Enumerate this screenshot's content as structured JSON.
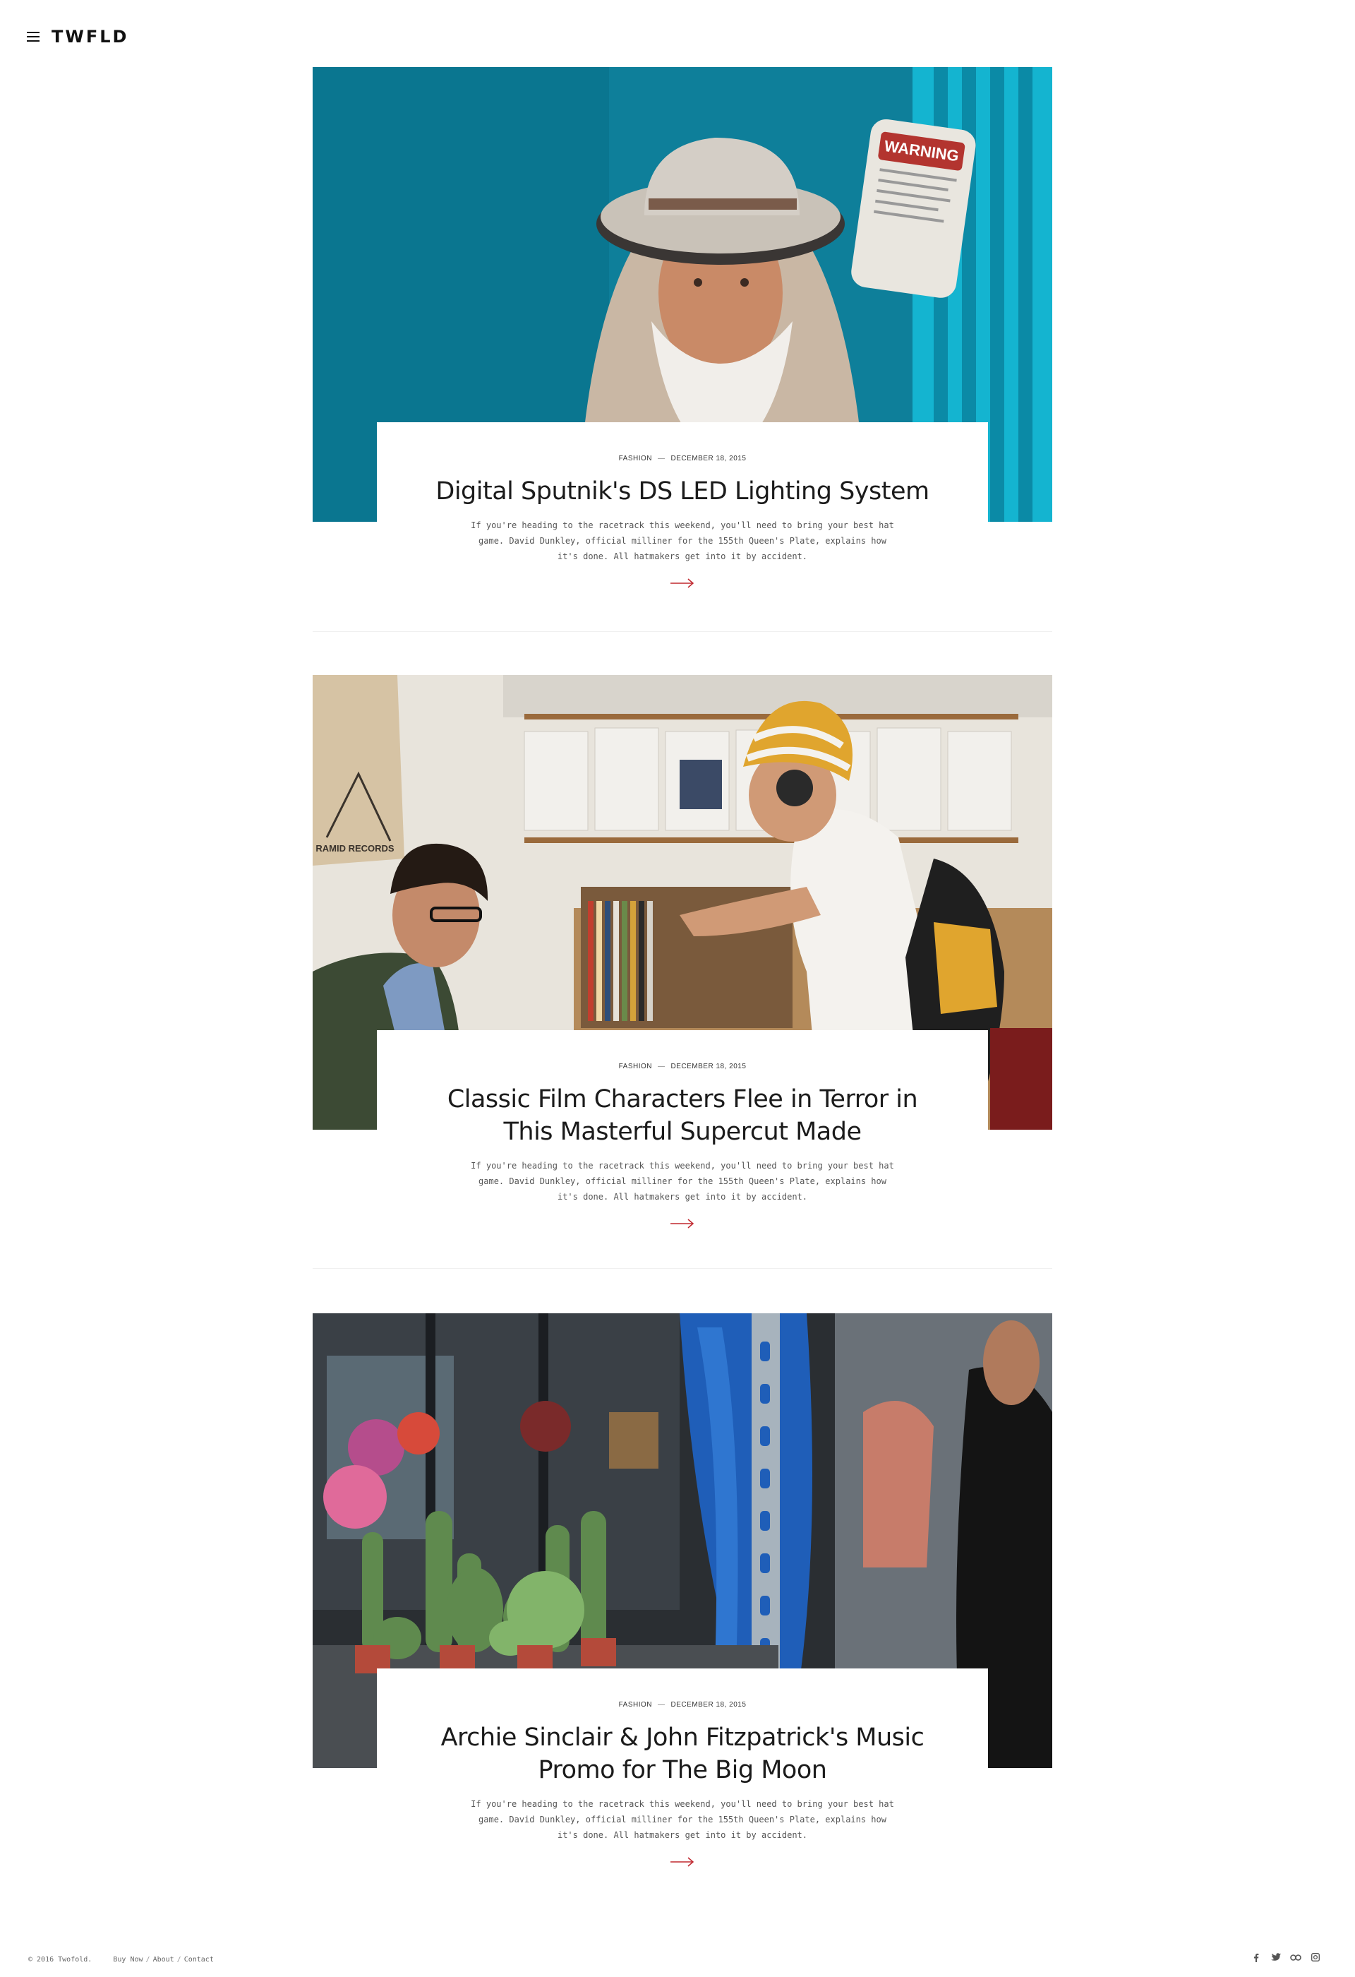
{
  "header": {
    "logo": "TWFLD"
  },
  "posts": [
    {
      "category": "Fashion",
      "date": "December 18, 2015",
      "title": "Digital Sputnik's DS LED Lighting System",
      "excerpt": "If you're heading to the racetrack this weekend, you'll need to bring your best hat game. David Dunkley, official milliner for the 155th Queen's Plate, explains how it's done. All hatmakers get into it by accident.",
      "sign_text": "WARNING"
    },
    {
      "category": "Fashion",
      "date": "December 18, 2015",
      "title": "Classic Film Characters Flee in Terror in This Masterful Supercut Made",
      "excerpt": "If you're heading to the racetrack this weekend, you'll need to bring your best hat game. David Dunkley, official milliner for the 155th Queen's Plate, explains how it's done. All hatmakers get into it by accident.",
      "bag_text": "RAMID RECORDS"
    },
    {
      "category": "Fashion",
      "date": "December 18, 2015",
      "title": "Archie Sinclair & John Fitzpatrick's Music Promo for The Big Moon",
      "excerpt": "If you're heading to the racetrack this weekend, you'll need to bring your best hat game. David Dunkley, official milliner for the 155th Queen's Plate, explains how it's done. All hatmakers get into it by accident."
    }
  ],
  "footer": {
    "copyright": "© 2016 Twofold.",
    "links": [
      "Buy Now",
      "About",
      "Contact"
    ],
    "social_icons": [
      "facebook-icon",
      "twitter-icon",
      "flickr-icon",
      "instagram-icon"
    ]
  },
  "colors": {
    "accent": "#c0282f",
    "text": "#1a1a1a"
  }
}
